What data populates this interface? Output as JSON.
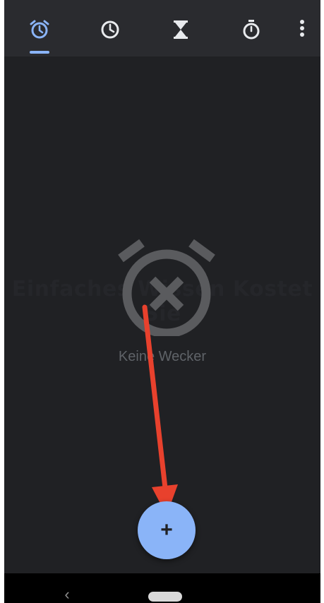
{
  "tabs": [
    {
      "icon": "alarm-icon",
      "active": true
    },
    {
      "icon": "clock-icon",
      "active": false
    },
    {
      "icon": "timer-icon",
      "active": false
    },
    {
      "icon": "stopwatch-icon",
      "active": false
    }
  ],
  "menu_icon": "more-vert-icon",
  "empty_state": {
    "label": "Keine Wecker",
    "icon": "alarm-off-icon",
    "watermark": "Einfaches Wissen Kostet Sie"
  },
  "fab": {
    "symbol": "+",
    "icon": "add-icon"
  },
  "annotation_arrow": {
    "color": "#e8412d"
  },
  "navbar": {
    "back_symbol": "‹",
    "home_icon": "home-pill-icon"
  },
  "colors": {
    "background": "#202124",
    "tabbar": "#2a2b2f",
    "accent": "#8ab4f8",
    "icon_inactive": "#e8eaed",
    "empty_text": "#5f6368"
  }
}
